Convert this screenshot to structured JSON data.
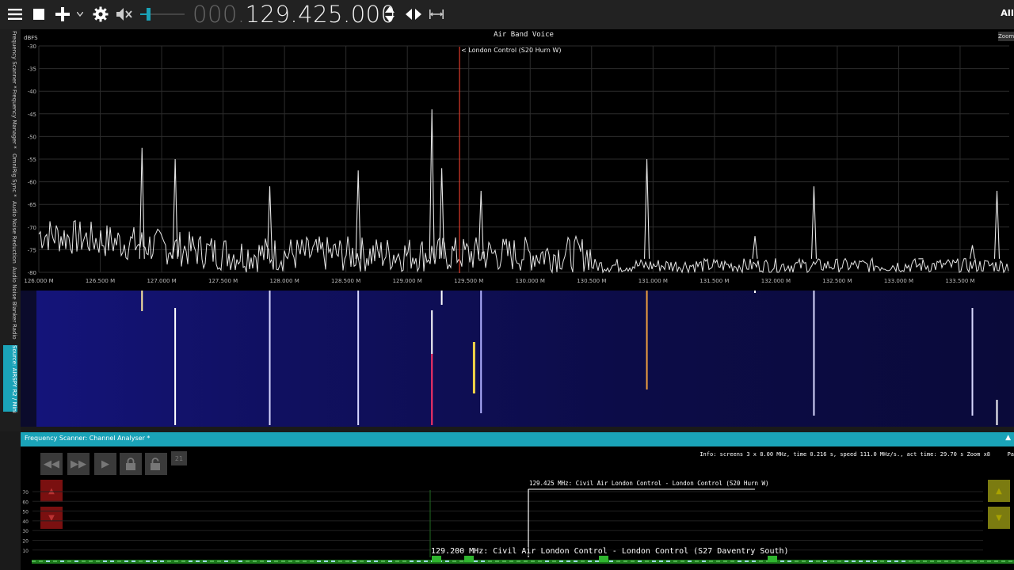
{
  "toolbar": {
    "freq_dim": "000.",
    "freq_lit": "129.425.000",
    "brand": "AII"
  },
  "sidebar": {
    "tabs": [
      {
        "label": "Frequency Scanner *"
      },
      {
        "label": "Frequency Manager *"
      },
      {
        "label": "OmniRig Sync *"
      },
      {
        "label": "Audio Noise Reduction"
      },
      {
        "label": "Audio Noise Blanker"
      },
      {
        "label": "Radio"
      },
      {
        "label": "Source: AIRSPY R2 / Mini"
      }
    ]
  },
  "spectrum": {
    "title": "Air Band Voice",
    "unit_label": "dBFS",
    "zoom_label": "Zoom",
    "marker_label": "London Control (S20 Hurn W)",
    "y_ticks": [
      "-30",
      "-35",
      "-40",
      "-45",
      "-50",
      "-55",
      "-60",
      "-65",
      "-70",
      "-75",
      "-80"
    ],
    "x_ticks": [
      "126.000 M",
      "126.500 M",
      "127.000 M",
      "127.500 M",
      "128.000 M",
      "128.500 M",
      "129.000 M",
      "129.500 M",
      "130.000 M",
      "130.500 M",
      "131.000 M",
      "131.500 M",
      "132.000 M",
      "132.500 M",
      "133.000 M",
      "133.500 M"
    ]
  },
  "chart_data": {
    "type": "line",
    "title": "Air Band Voice",
    "ylabel": "dBFS",
    "xlim": [
      126.0,
      133.9
    ],
    "ylim": [
      -80,
      -30
    ],
    "noise_floor": -77,
    "peaks": [
      {
        "x": 126.84,
        "y": -52.5
      },
      {
        "x": 127.11,
        "y": -55
      },
      {
        "x": 127.88,
        "y": -61
      },
      {
        "x": 128.6,
        "y": -57.5
      },
      {
        "x": 129.2,
        "y": -44
      },
      {
        "x": 129.28,
        "y": -57
      },
      {
        "x": 129.6,
        "y": -62
      },
      {
        "x": 130.95,
        "y": -55
      },
      {
        "x": 131.83,
        "y": -72
      },
      {
        "x": 132.31,
        "y": -61
      },
      {
        "x": 133.18,
        "y": -77
      },
      {
        "x": 133.6,
        "y": -74
      },
      {
        "x": 133.8,
        "y": -62
      }
    ],
    "marker_x": 129.425
  },
  "panel": {
    "title": "Frequency Scanner: Channel Analyser *",
    "info": "Info: screens 3 x 8.00 MHz, time   0.216 s, speed 111.0 MHz/s., act time:  29.70 s Zoom x8",
    "info_tail": "Pa",
    "ca_label_top": "129.425 MHz: Civil Air London Control - London Control (S20 Hurn W)",
    "ca_label_bottom": "129.200 MHz: Civil Air London Control - London Control (S27 Daventry South)",
    "y_ticks": [
      "70",
      "60",
      "50",
      "40",
      "30",
      "20",
      "10"
    ],
    "ctrl_icon": "21"
  },
  "colors": {
    "accent": "#1aa3b8",
    "marker": "#e03a2a",
    "trace": "#e6e6e6"
  }
}
